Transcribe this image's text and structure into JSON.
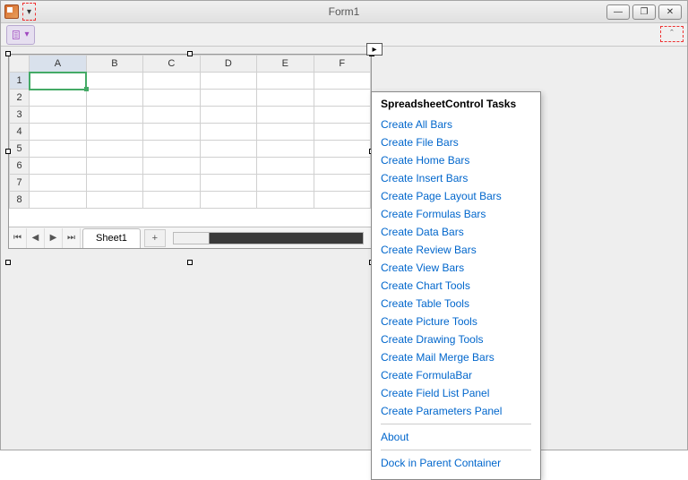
{
  "window": {
    "title": "Form1"
  },
  "win_buttons": {
    "min": "—",
    "max": "❐",
    "close": "✕"
  },
  "qat": {
    "dropdown_glyph": "▾"
  },
  "ribbon": {
    "file_glyph": "▾",
    "collapse_glyph": "ˆ"
  },
  "smart_tag": {
    "glyph": "▸"
  },
  "columns": [
    "A",
    "B",
    "C",
    "D",
    "E",
    "F"
  ],
  "rows": [
    "1",
    "2",
    "3",
    "4",
    "5",
    "6",
    "7",
    "8"
  ],
  "sheet": {
    "nav_first": "⏮",
    "nav_prev": "◀",
    "nav_next": "▶",
    "nav_last": "⏭",
    "tab": "Sheet1",
    "add": "+"
  },
  "tasks": {
    "title": "SpreadsheetControl Tasks",
    "group1": [
      "Create All Bars",
      "Create File Bars",
      "Create Home Bars",
      "Create Insert Bars",
      "Create Page Layout Bars",
      "Create Formulas Bars",
      "Create Data Bars",
      "Create Review Bars",
      "Create View Bars",
      "Create Chart Tools",
      "Create Table Tools",
      "Create Picture Tools",
      "Create Drawing Tools",
      "Create Mail Merge Bars",
      "Create FormulaBar",
      "Create Field List Panel",
      "Create Parameters Panel"
    ],
    "group2": [
      "About"
    ],
    "group3": [
      "Dock in Parent Container"
    ]
  }
}
